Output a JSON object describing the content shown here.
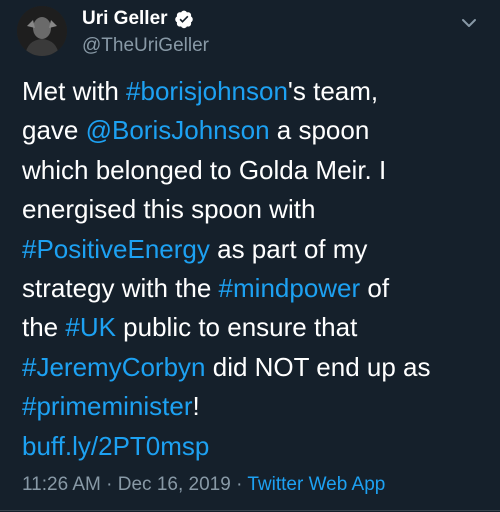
{
  "user": {
    "display_name": "Uri Geller",
    "handle": "@TheUriGeller"
  },
  "tweet": {
    "segments": [
      {
        "text": "Met with ",
        "link": false
      },
      {
        "text": "#borisjohnson",
        "link": true
      },
      {
        "text": "'s team,\ngave ",
        "link": false
      },
      {
        "text": "@BorisJohnson",
        "link": true
      },
      {
        "text": " a spoon\nwhich belonged to Golda Meir. I\nenergised this spoon with\n",
        "link": false
      },
      {
        "text": "#PositiveEnergy",
        "link": true
      },
      {
        "text": " as part of my\nstrategy with the ",
        "link": false
      },
      {
        "text": "#mindpower",
        "link": true
      },
      {
        "text": " of\nthe ",
        "link": false
      },
      {
        "text": "#UK",
        "link": true
      },
      {
        "text": " public to ensure that\n",
        "link": false
      },
      {
        "text": "#JeremyCorbyn",
        "link": true
      },
      {
        "text": " did NOT end up as\n",
        "link": false
      },
      {
        "text": "#primeminister",
        "link": true
      },
      {
        "text": "!\n",
        "link": false
      },
      {
        "text": "buff.ly/2PT0msp",
        "link": true
      }
    ]
  },
  "meta": {
    "time": "11:26 AM",
    "date": "Dec 16, 2019",
    "source": "Twitter Web App"
  },
  "colors": {
    "background": "#15202b",
    "link": "#1da1f2",
    "muted": "#8899a6",
    "verified_badge": "#ffffff"
  },
  "icons": {
    "verified": "verified-badge-icon",
    "menu": "chevron-down-icon"
  }
}
